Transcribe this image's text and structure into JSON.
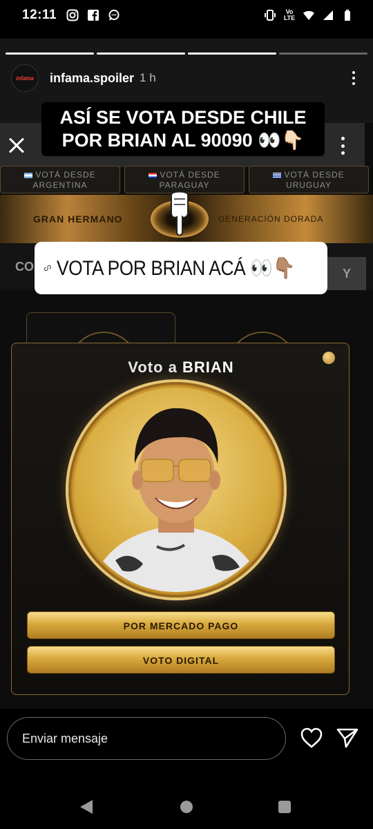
{
  "status_bar": {
    "time": "12:11",
    "notification_icons": [
      "instagram-icon",
      "facebook-icon",
      "chat-icon"
    ],
    "system_icons": [
      "vibrate-icon",
      "volte-icon",
      "wifi-icon",
      "signal-icon",
      "battery-icon"
    ],
    "volte_label": "Vo LTE"
  },
  "story": {
    "progress_segments": 4,
    "active_segment_index": 3,
    "account_name": "infama.spoiler",
    "avatar_text": "infama",
    "age": "1 h"
  },
  "stickers": {
    "title_line1": "ASÍ SE VOTA DESDE CHILE",
    "title_line2": "POR BRIAN AL 90090 👀👇🏻",
    "link_label": "VOTA POR BRIAN ACÁ 👀👇🏽"
  },
  "embedded_page": {
    "countries": [
      {
        "line1": "VOTÁ DESDE",
        "line2": "ARGENTINA"
      },
      {
        "line1": "VOTÁ DESDE",
        "line2": "PARAGUAY"
      },
      {
        "line1": "VOTÁ DESDE",
        "line2": "URUGUAY"
      }
    ],
    "banner_left": "GRAN HERMANO",
    "banner_right": "GENERACIÓN DORADA",
    "tab_left": "CO",
    "tab_right": "Y"
  },
  "vote_modal": {
    "title_prefix": "Voto a",
    "title_name": "BRIAN",
    "button_mercado_pago": "POR MERCADO PAGO",
    "button_digital": "VOTO DIGITAL"
  },
  "reply": {
    "placeholder": "Enviar mensaje"
  },
  "colors": {
    "gold_light": "#f6dc8c",
    "gold_dark": "#b07e22",
    "background": "#000000"
  }
}
